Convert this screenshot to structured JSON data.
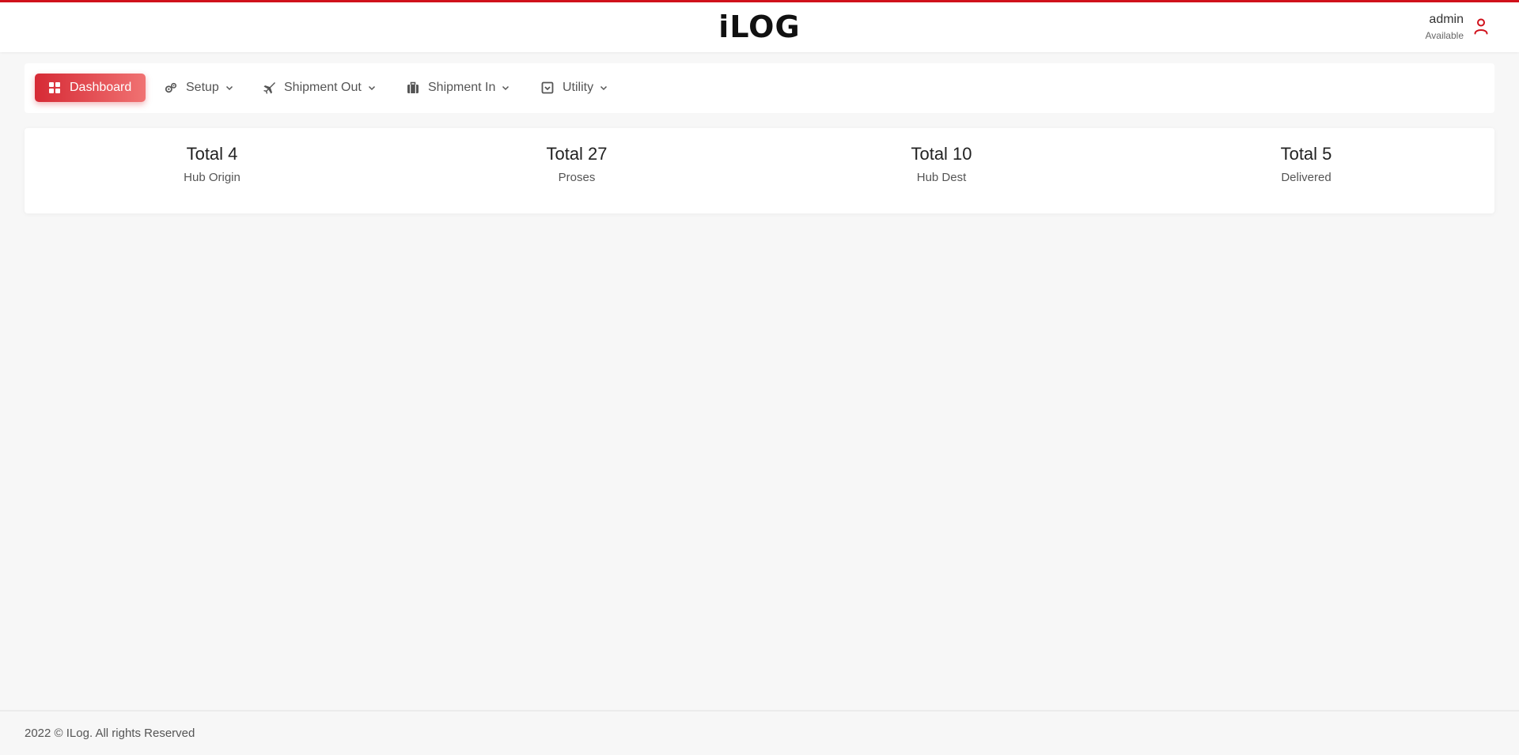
{
  "header": {
    "logo": "iLOG",
    "user": {
      "name": "admin",
      "status": "Available",
      "icon": "user-icon"
    }
  },
  "nav": {
    "items": [
      {
        "label": "Dashboard",
        "icon": "dashboard-grid-icon",
        "active": true
      },
      {
        "label": "Setup",
        "icon": "gears-icon",
        "dropdown": true
      },
      {
        "label": "Shipment Out",
        "icon": "plane-icon",
        "dropdown": true
      },
      {
        "label": "Shipment In",
        "icon": "suitcase-icon",
        "dropdown": true
      },
      {
        "label": "Utility",
        "icon": "inbox-check-icon",
        "dropdown": true
      }
    ]
  },
  "stats": [
    {
      "value": "Total 4",
      "label": "Hub Origin"
    },
    {
      "value": "Total 27",
      "label": "Proses"
    },
    {
      "value": "Total 10",
      "label": "Hub Dest"
    },
    {
      "value": "Total 5",
      "label": "Delivered"
    }
  ],
  "footer": {
    "text": "2022 © ILog. All rights Reserved"
  },
  "colors": {
    "accent": "#d0111b",
    "active_gradient_start": "#d62a35",
    "active_gradient_end": "#f07272",
    "background": "#f7f7f7"
  }
}
